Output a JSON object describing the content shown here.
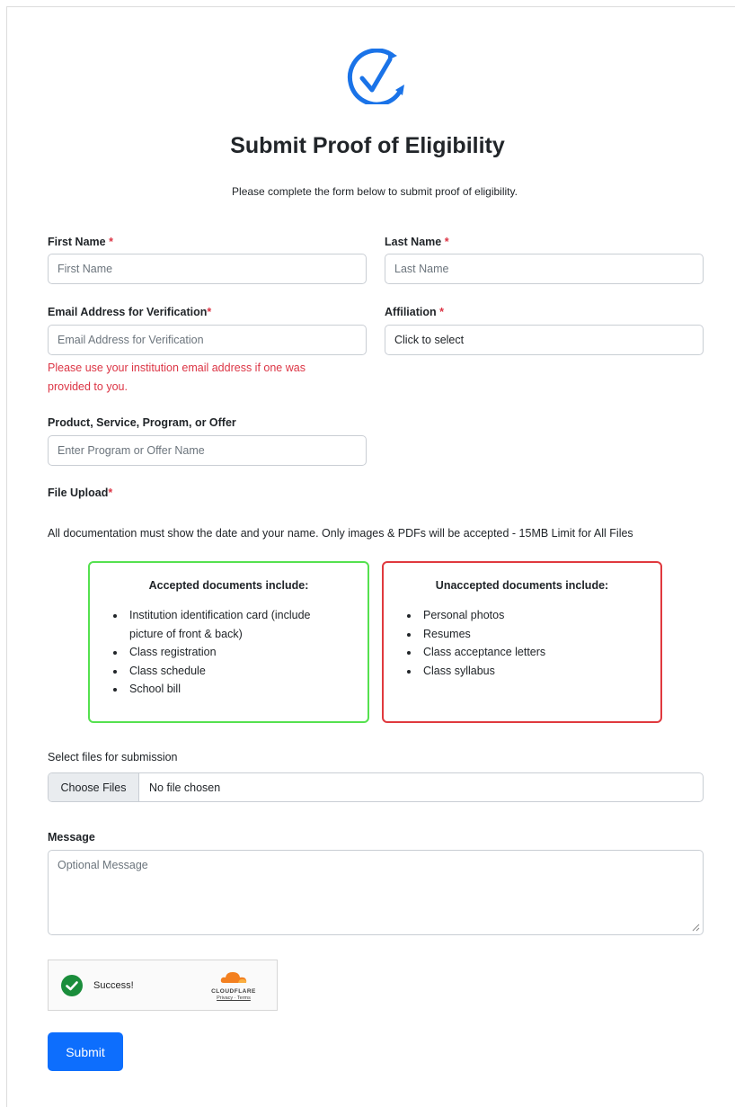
{
  "header": {
    "logo_icon": "check-circle-icon",
    "title": "Submit Proof of Eligibility",
    "subtitle": "Please complete the form below to submit proof of eligibility."
  },
  "fields": {
    "first_name": {
      "label": "First Name",
      "required_mark": "*",
      "placeholder": "First Name"
    },
    "last_name": {
      "label": "Last Name",
      "required_mark": "*",
      "placeholder": "Last Name"
    },
    "email": {
      "label": "Email Address for Verification",
      "required_mark": "*",
      "placeholder": "Email Address for Verification",
      "hint_line1": "Please use your institution email address if one was",
      "hint_line2": "provided to you."
    },
    "affiliation": {
      "label": "Affiliation",
      "required_mark": "*",
      "value": "Click to select"
    },
    "program": {
      "label": "Product, Service, Program, or Offer",
      "placeholder": "Enter Program or Offer Name"
    }
  },
  "file_upload": {
    "label": "File Upload",
    "required_mark": "*",
    "instructions": "All documentation must show the date and your name. Only images & PDFs will be accepted - 15MB Limit for All Files",
    "accepted": {
      "title": "Accepted documents include:",
      "items": [
        "Institution identification card (include",
        "Class registration",
        "Class schedule",
        "School bill"
      ],
      "item0_continued": "picture of front & back)"
    },
    "unaccepted": {
      "title": "Unaccepted documents include:",
      "items": [
        "Personal photos",
        "Resumes",
        "Class acceptance letters",
        "Class syllabus"
      ]
    },
    "select_label": "Select files for submission",
    "choose_button": "Choose Files",
    "no_file_text": "No file chosen"
  },
  "message": {
    "label": "Message",
    "placeholder": "Optional Message"
  },
  "captcha": {
    "status": "Success!",
    "status_icon": "check-circle-icon",
    "brand": "CLOUDFLARE",
    "links": "Privacy · Terms"
  },
  "submit_label": "Submit",
  "colors": {
    "primary": "#0d6efd",
    "required": "#dc3545",
    "accepted_border": "#55e14f",
    "unaccepted_border": "#e0393e",
    "logo_blue": "#1a73e8",
    "success_green": "#1a8d3b",
    "cloudflare_orange": "#f38020"
  }
}
